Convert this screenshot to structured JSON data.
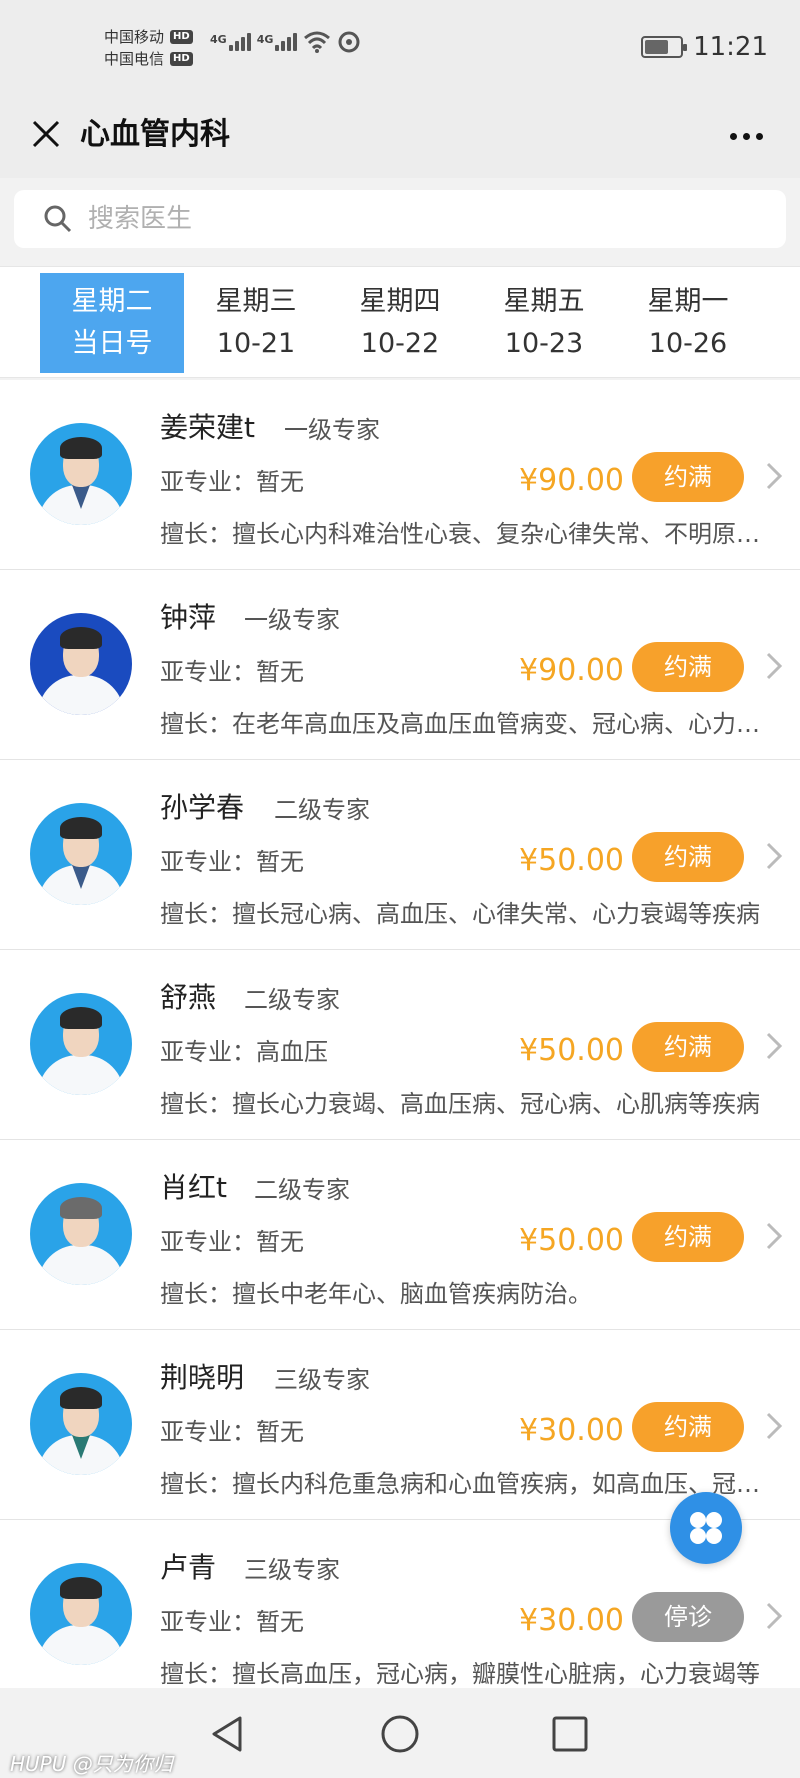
{
  "status_bar": {
    "carrier1": "中国移动",
    "carrier2": "中国电信",
    "hd": "HD",
    "net1": "4G",
    "net2": "4G",
    "time": "11:21"
  },
  "nav": {
    "title": "心血管内科"
  },
  "search": {
    "placeholder": "搜索医生"
  },
  "date_tabs": [
    {
      "day": "星期二",
      "date": "当日号",
      "active": true
    },
    {
      "day": "星期三",
      "date": "10-21",
      "active": false
    },
    {
      "day": "星期四",
      "date": "10-22",
      "active": false
    },
    {
      "day": "星期五",
      "date": "10-23",
      "active": false
    },
    {
      "day": "星期一",
      "date": "10-26",
      "active": false
    }
  ],
  "doctors": [
    {
      "name": "姜荣建t",
      "level": "一级专家",
      "sub": "亚专业：暂无",
      "price": "¥90.00",
      "status": "约满",
      "skill": "擅长：擅长心内科难治性心衰、复杂心律失常、不明原因胸痛等"
    },
    {
      "name": "钟萍",
      "level": "一级专家",
      "sub": "亚专业：暂无",
      "price": "¥90.00",
      "status": "约满",
      "skill": "擅长：在老年高血压及高血压血管病变、冠心病、心力衰竭等"
    },
    {
      "name": "孙学春",
      "level": "二级专家",
      "sub": "亚专业：暂无",
      "price": "¥50.00",
      "status": "约满",
      "skill": "擅长：擅长冠心病、高血压、心律失常、心力衰竭等疾病"
    },
    {
      "name": "舒燕",
      "level": "二级专家",
      "sub": "亚专业：高血压",
      "price": "¥50.00",
      "status": "约满",
      "skill": "擅长：擅长心力衰竭、高血压病、冠心病、心肌病等疾病"
    },
    {
      "name": "肖红t",
      "level": "二级专家",
      "sub": "亚专业：暂无",
      "price": "¥50.00",
      "status": "约满",
      "skill": "擅长：擅长中老年心、脑血管疾病防治。"
    },
    {
      "name": "荆晓明",
      "level": "三级专家",
      "sub": "亚专业：暂无",
      "price": "¥30.00",
      "status": "约满",
      "skill": "擅长：擅长内科危重急病和心血管疾病，如高血压、冠心病"
    },
    {
      "name": "卢青",
      "level": "三级专家",
      "sub": "亚专业：暂无",
      "price": "¥30.00",
      "status": "停诊",
      "skill": "擅长：擅长高血压，冠心病，瓣膜性心脏病，心力衰竭等"
    }
  ],
  "watermark": "HUPU @只为你归",
  "colors": {
    "accent": "#4da6ef",
    "price": "#f5a623",
    "full_button": "#f7a12b",
    "stopped_button": "#9a9a9a"
  }
}
